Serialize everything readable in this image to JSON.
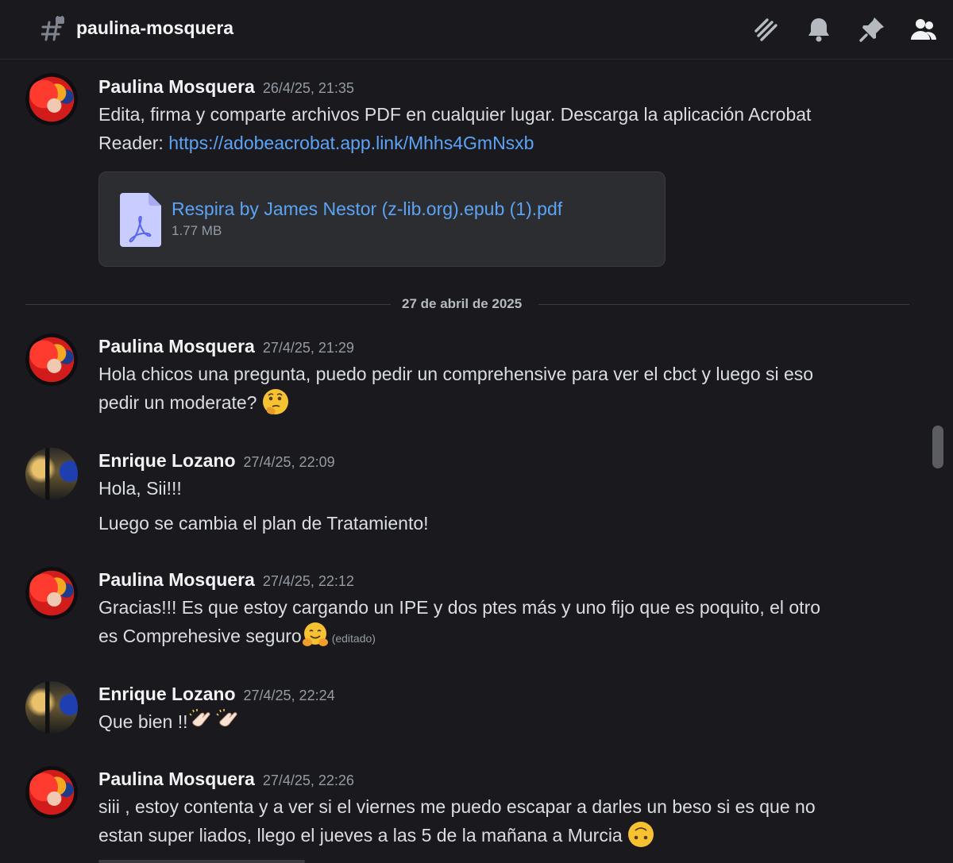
{
  "header": {
    "channel_name": "paulina-mosquera",
    "icons": [
      "hash-lock-icon",
      "threads-icon",
      "bell-icon",
      "pin-icon",
      "members-icon"
    ]
  },
  "messages": [
    {
      "author": "Paulina Mosquera",
      "timestamp": "26/4/25, 21:35",
      "text_line1": "Edita, firma y comparte archivos PDF en cualquier lugar. Descarga la aplicación Acrobat",
      "text_prefix": "Reader: ",
      "link": "https://adobeacrobat.app.link/Mhhs4GmNsxb",
      "attachment": {
        "name": "Respira by James Nestor (z-lib.org).epub (1).pdf",
        "size": "1.77 MB",
        "icon": "pdf-file-icon"
      }
    },
    {
      "author": "Paulina Mosquera",
      "timestamp": "27/4/25, 21:29",
      "text_line1": "Hola chicos una pregunta, puedo pedir un comprehensive para ver el cbct y luego si eso",
      "text_line2": "pedir un moderate?",
      "emoji": "thinking-face-emoji"
    },
    {
      "author": "Enrique Lozano",
      "timestamp": "27/4/25, 22:09",
      "text_line1": "Hola, Sii!!!",
      "text_line2": "Luego se cambia el plan de Tratamiento!"
    },
    {
      "author": "Paulina Mosquera",
      "timestamp": "27/4/25, 22:12",
      "text_line1": "Gracias!!! Es que estoy cargando un IPE y dos ptes más y uno fijo que es poquito, el otro",
      "text_line2": "es Comprehesive seguro",
      "emoji": "hugging-face-emoji",
      "edited": "(editado)"
    },
    {
      "author": "Enrique Lozano",
      "timestamp": "27/4/25, 22:24",
      "text_line1": "Que bien !!",
      "emoji": "clapping-hands-emoji"
    },
    {
      "author": "Paulina Mosquera",
      "timestamp": "27/4/25, 22:26",
      "text_line1": "siii , estoy contenta y a ver si el viernes me puedo escapar a darles un beso si es que no",
      "text_line2": "estan super liados, llego el jueves a las 5 de la mañana a Murcia",
      "emoji": "upside-down-face-emoji"
    }
  ],
  "date_divider": "27 de abril de 2025",
  "colors": {
    "background": "#1a1a1e",
    "link": "#5ca3f5",
    "muted": "#949ba4",
    "attachment_bg": "#2b2d31"
  }
}
